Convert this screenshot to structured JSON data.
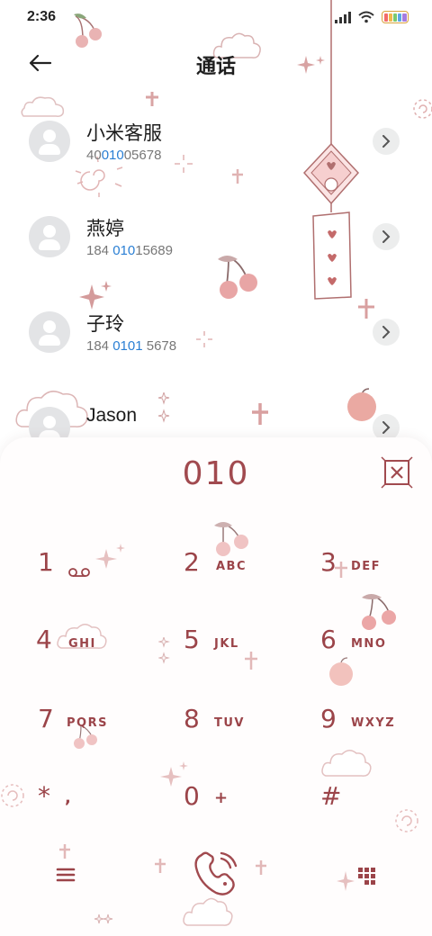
{
  "status": {
    "time": "2:36"
  },
  "header": {
    "title": "通话"
  },
  "contacts": [
    {
      "name": "小米客服",
      "number_pre": "40",
      "number_hl": "010",
      "number_post": "05678"
    },
    {
      "name": "燕婷",
      "number_pre": "184 ",
      "number_hl": "010",
      "number_post": "15689"
    },
    {
      "name": "子玲",
      "number_pre": "184 ",
      "number_hl": "0101",
      "number_post": " 5678"
    },
    {
      "name": "Jason",
      "number_pre": "",
      "number_hl": "",
      "number_post": ""
    }
  ],
  "dialer": {
    "number": "010",
    "keys": [
      {
        "digit": "1",
        "letters": ""
      },
      {
        "digit": "2",
        "letters": "ABC"
      },
      {
        "digit": "3",
        "letters": "DEF"
      },
      {
        "digit": "4",
        "letters": "GHI"
      },
      {
        "digit": "5",
        "letters": "JKL"
      },
      {
        "digit": "6",
        "letters": "MNO"
      },
      {
        "digit": "7",
        "letters": "PQRS"
      },
      {
        "digit": "8",
        "letters": "TUV"
      },
      {
        "digit": "9",
        "letters": "WXYZ"
      },
      {
        "digit": "*",
        "letters": ","
      },
      {
        "digit": "0",
        "letters": "+"
      },
      {
        "digit": "#",
        "letters": ""
      }
    ]
  },
  "icons": {
    "back": "back-arrow-icon",
    "detail": "chevron-right-icon",
    "delete": "backspace-icon",
    "voicemail": "voicemail-icon",
    "menu": "menu-icon",
    "call": "phone-call-icon",
    "keypad": "keypad-grid-icon"
  },
  "colors": {
    "accent": "#9b4449",
    "highlight": "#2a7fd4",
    "avatar": "#e3e4e6"
  }
}
